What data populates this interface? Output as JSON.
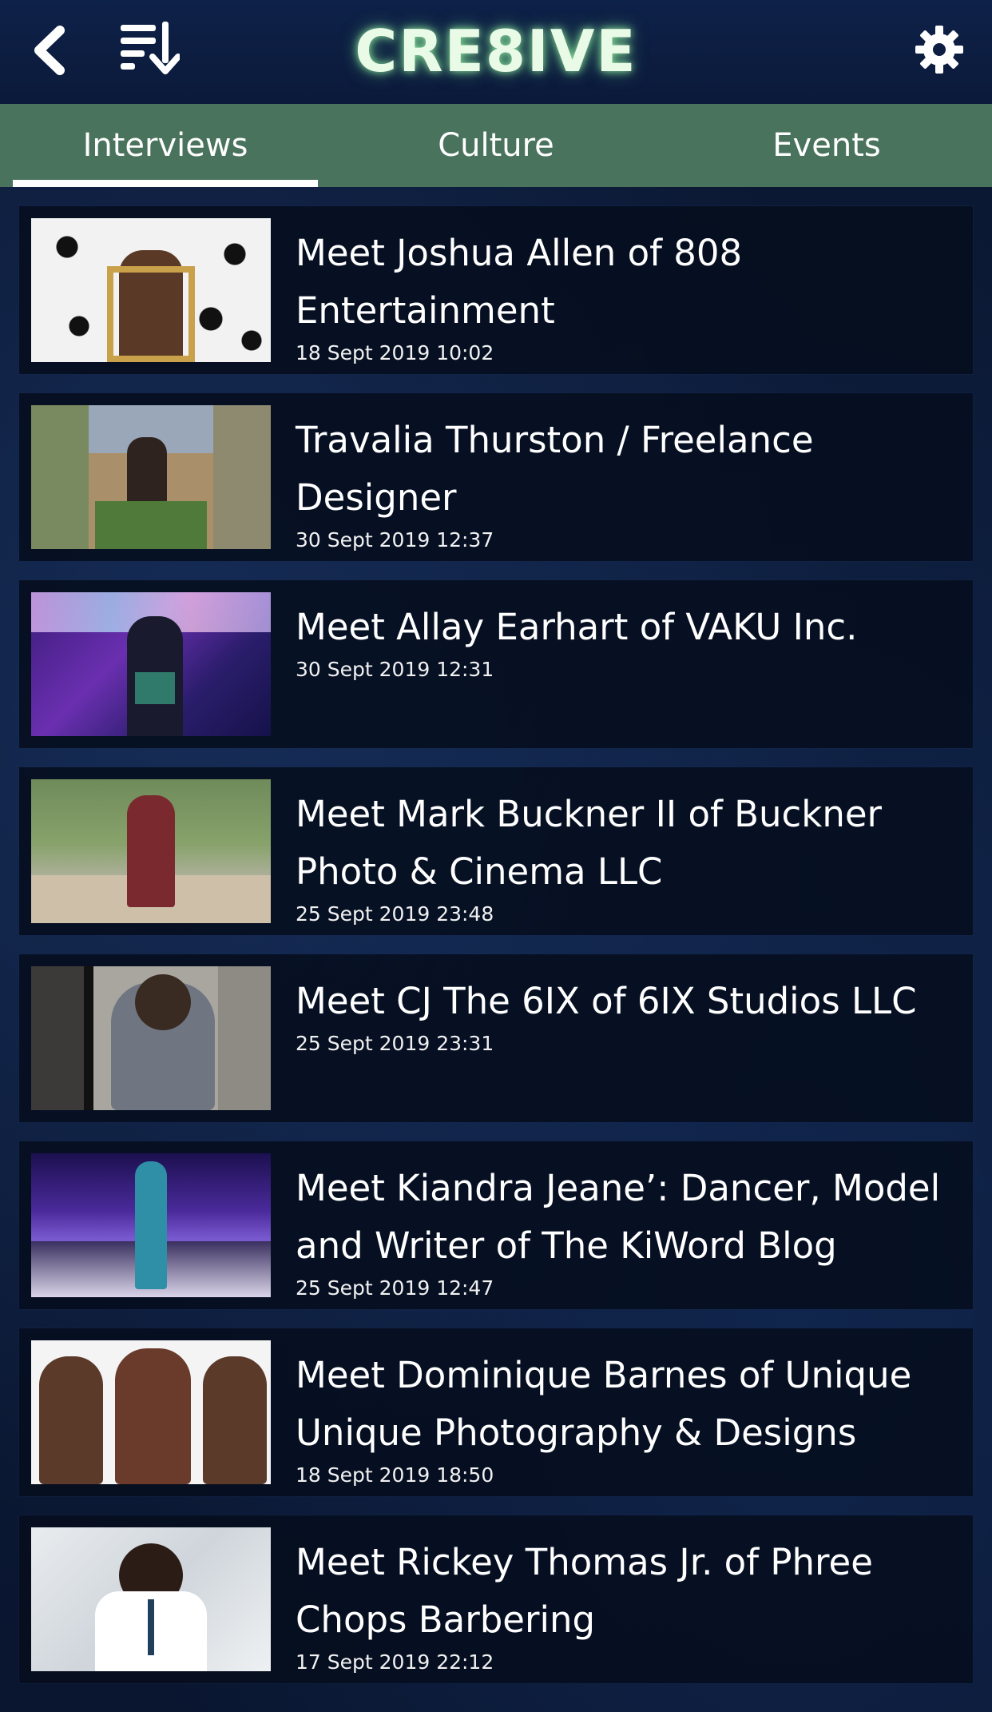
{
  "header": {
    "logo": "CRE8IVE"
  },
  "tabs": [
    {
      "label": "Interviews",
      "active": true
    },
    {
      "label": "Culture",
      "active": false
    },
    {
      "label": "Events",
      "active": false
    }
  ],
  "articles": [
    {
      "title": "Meet Joshua Allen of 808 Entertainment",
      "date": "18 Sept 2019 10:02"
    },
    {
      "title": "Travalia Thurston / Freelance Designer",
      "date": "30 Sept 2019 12:37"
    },
    {
      "title": "Meet Allay Earhart of VAKU Inc.",
      "date": "30 Sept 2019 12:31"
    },
    {
      "title": "Meet Mark Buckner II of Buckner Photo & Cinema LLC",
      "date": "25 Sept 2019 23:48"
    },
    {
      "title": "Meet CJ The 6IX of 6IX Studios LLC",
      "date": "25 Sept 2019 23:31"
    },
    {
      "title": "Meet Kiandra Jeane’: Dancer, Model and Writer of The KiWord Blog",
      "date": "25 Sept 2019 12:47"
    },
    {
      "title": "Meet Dominique Barnes of Unique Unique Photography & Designs",
      "date": "18 Sept 2019 18:50"
    },
    {
      "title": "Meet Rickey Thomas Jr. of Phree Chops Barbering",
      "date": "17 Sept 2019 22:12"
    }
  ],
  "icons": {
    "back": "back-chevron-icon",
    "sort": "sort-list-icon",
    "settings": "gear-icon"
  },
  "colors": {
    "tab_bar": "#49735c",
    "header": "#0e2148",
    "logo_glow": "#a0ffaa"
  }
}
